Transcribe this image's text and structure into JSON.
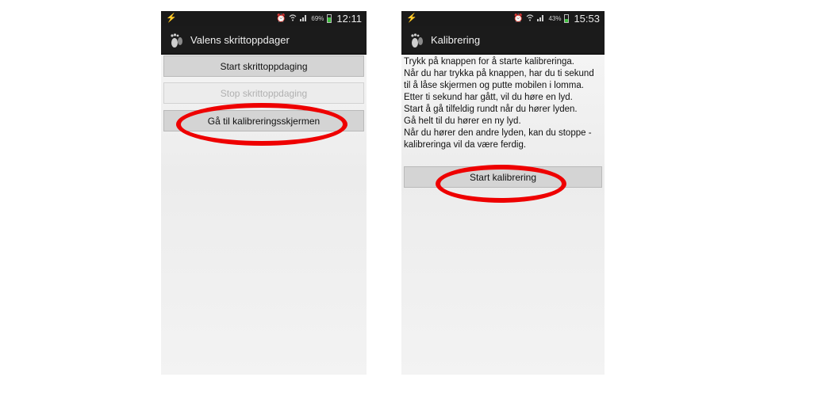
{
  "left_screen": {
    "status": {
      "battery_pct": "69%",
      "time": "12:11",
      "battery_level": 0.69
    },
    "app_title": "Valens skrittoppdager",
    "buttons": {
      "start": "Start skrittoppdaging",
      "stop": "Stop skrittoppdaging",
      "calibrate": "Gå til kalibreringsskjermen"
    }
  },
  "right_screen": {
    "status": {
      "battery_pct": "43%",
      "time": "15:53",
      "battery_level": 0.43
    },
    "app_title": "Kalibrering",
    "instructions": [
      "Trykk på knappen for å starte kalibreringa.",
      "Når du har trykka på knappen, har du ti sekund til å låse skjermen og putte mobilen i lomma.",
      "Etter ti sekund har gått, vil du høre en lyd.",
      "Start å gå tilfeldig rundt når du hører lyden.",
      "Gå helt til du hører en ny lyd.",
      "Når du hører den andre lyden, kan du stoppe - kalibreringa vil da være ferdig."
    ],
    "buttons": {
      "start_calibration": "Start kalibrering"
    }
  },
  "colors": {
    "highlight_ring": "#ee0000",
    "battery": "#3fbf3f"
  },
  "icons": [
    "lightning-icon",
    "alarm-icon",
    "wifi-icon",
    "signal-icon",
    "battery-icon",
    "footprint-icon"
  ]
}
